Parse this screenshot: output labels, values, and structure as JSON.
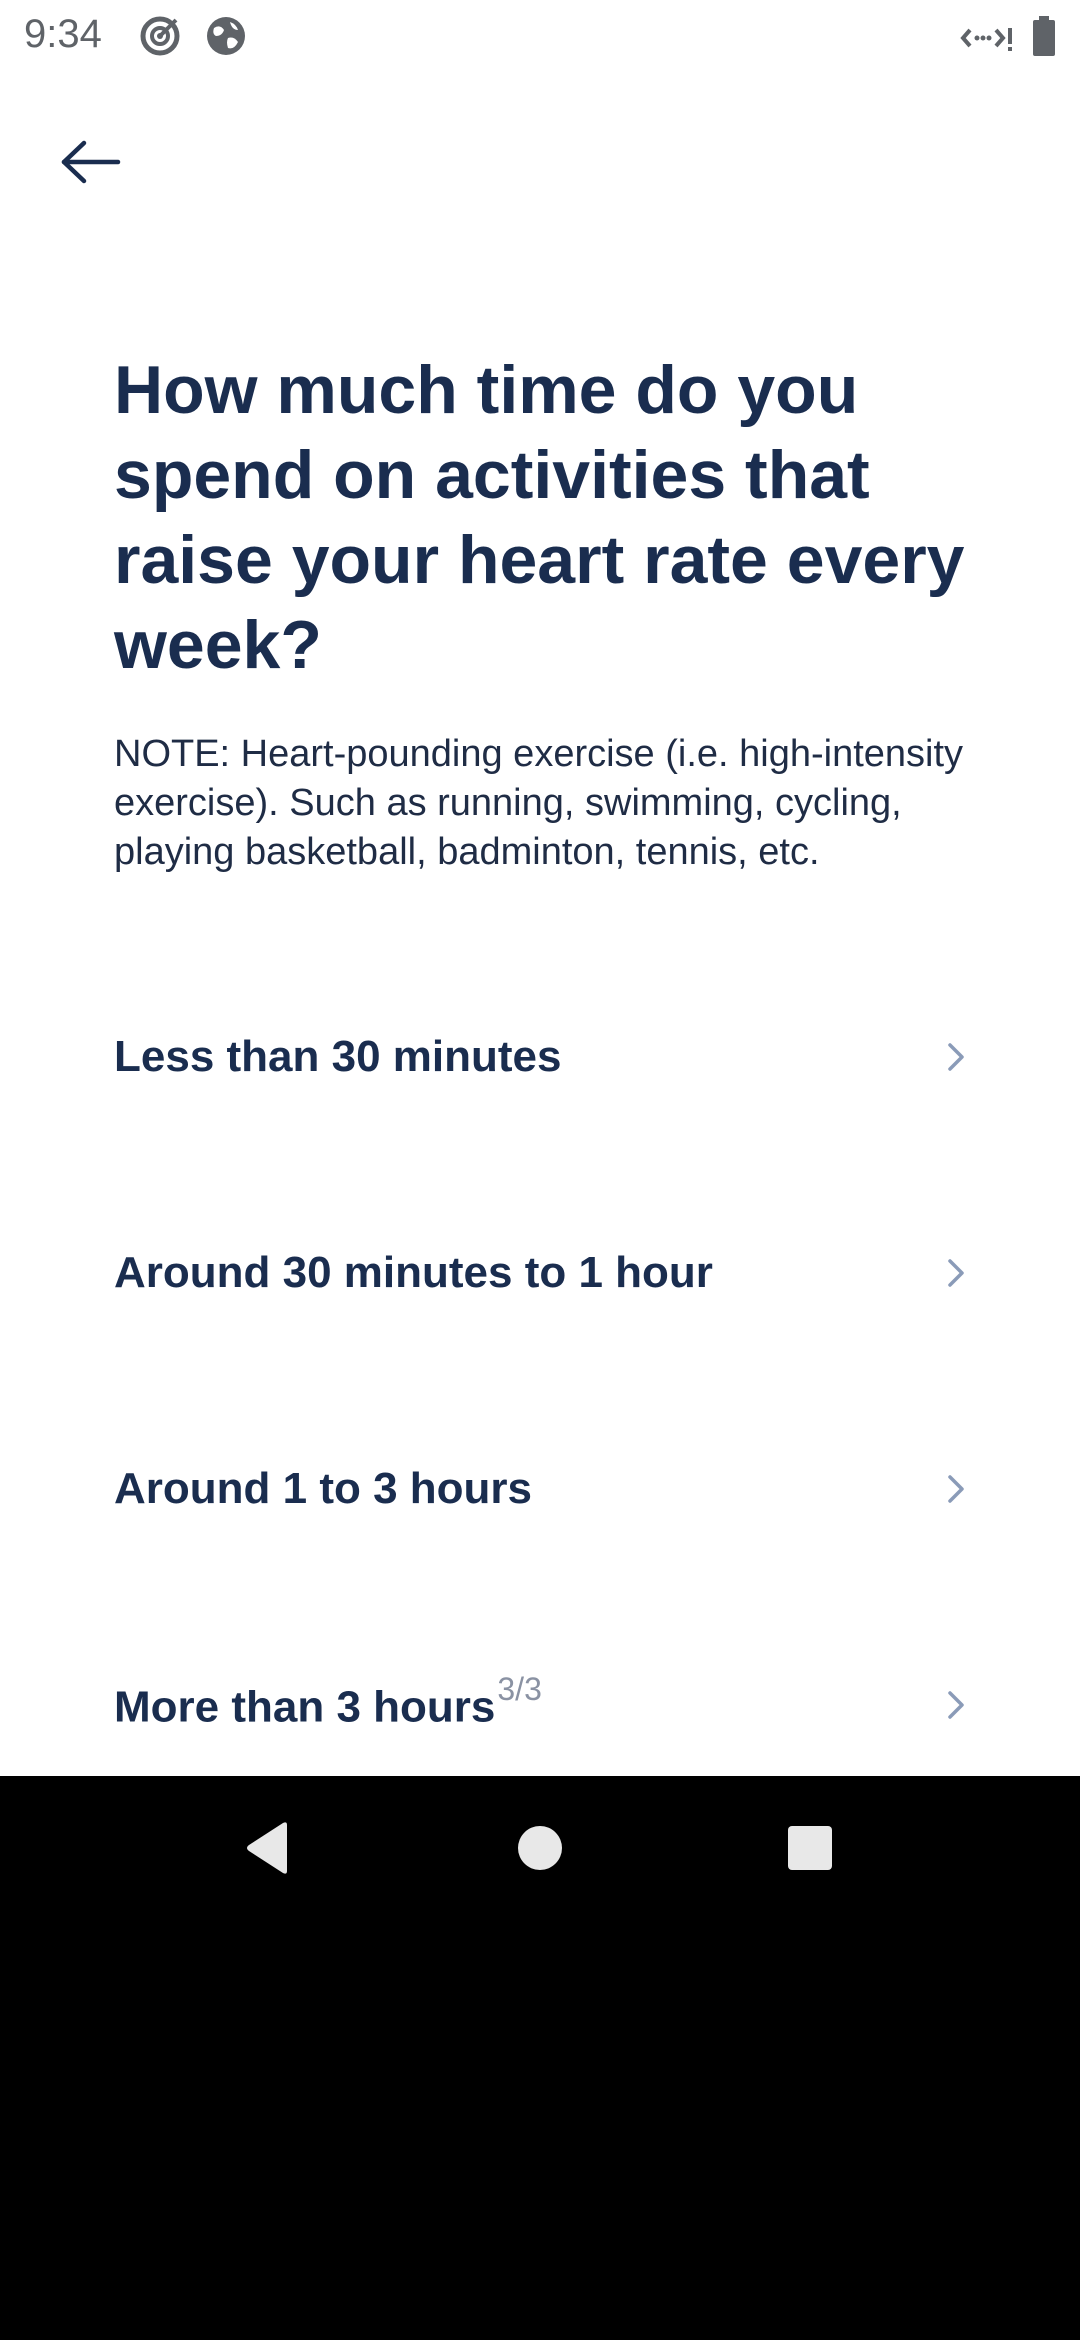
{
  "status_bar": {
    "time": "9:34",
    "icons": [
      "target-icon",
      "globe-icon",
      "network-icon",
      "battery-icon"
    ]
  },
  "header": {
    "back_icon": "arrow-left-icon"
  },
  "question": {
    "title": "How much time do you spend on activities that raise your heart rate every week?",
    "note": "NOTE: Heart-pounding exercise (i.e. high-intensity exercise). Such as running, swimming, cycling, playing basketball, badminton, tennis, etc."
  },
  "options": [
    {
      "label": "Less than 30 minutes"
    },
    {
      "label": "Around 30 minutes to 1 hour"
    },
    {
      "label": "Around 1 to 3 hours"
    },
    {
      "label": "More than 3 hours"
    }
  ],
  "page_indicator": "3/3",
  "colors": {
    "title": "#1a2d4f",
    "chevron": "#8a9bb8",
    "background": "#ffffff",
    "nav_bar": "#000000"
  },
  "nav_bar": {
    "buttons": [
      "back-triangle-icon",
      "home-circle-icon",
      "recents-square-icon"
    ]
  }
}
